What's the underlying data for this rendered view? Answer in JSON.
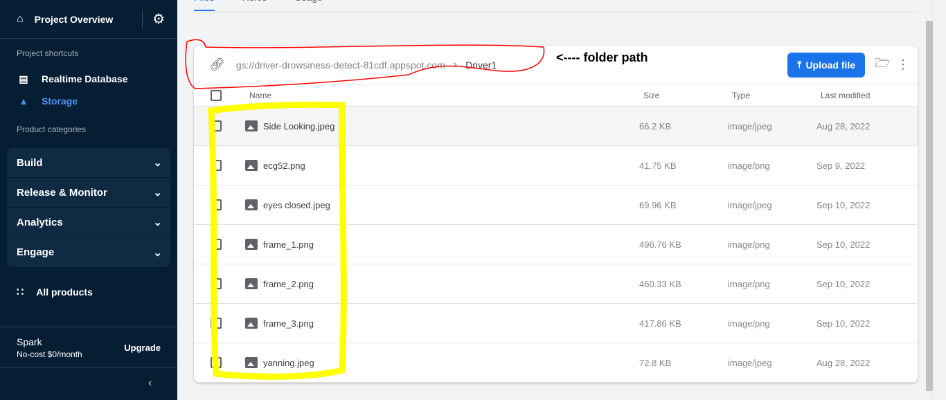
{
  "sidebar": {
    "project_overview": "Project Overview",
    "shortcuts_label": "Project shortcuts",
    "shortcuts": [
      {
        "label": "Realtime Database",
        "icon": "database-icon"
      },
      {
        "label": "Storage",
        "icon": "storage-folder-icon",
        "active": true
      }
    ],
    "categories_label": "Product categories",
    "groups": [
      {
        "label": "Build"
      },
      {
        "label": "Release & Monitor"
      },
      {
        "label": "Analytics"
      },
      {
        "label": "Engage"
      }
    ],
    "all_products": "All products",
    "plan_name": "Spark",
    "plan_desc": "No-cost $0/month",
    "upgrade": "Upgrade"
  },
  "tabs": [
    {
      "label": "Files",
      "active": true
    },
    {
      "label": "Rules"
    },
    {
      "label": "Usage"
    }
  ],
  "storage": {
    "bucket": "gs://driver-drowsiness-detect-81cdf.appspot.com",
    "folder": "Driver1",
    "upload_label": "Upload file",
    "columns": {
      "name": "Name",
      "size": "Size",
      "type": "Type",
      "modified": "Last modified"
    },
    "files": [
      {
        "name": "Side Looking.jpeg",
        "size": "66.2 KB",
        "type": "image/jpeg",
        "modified": "Aug 28, 2022"
      },
      {
        "name": "ecg52.png",
        "size": "41.75 KB",
        "type": "image/png",
        "modified": "Sep 9, 2022"
      },
      {
        "name": "eyes closed.jpeg",
        "size": "69.96 KB",
        "type": "image/jpeg",
        "modified": "Sep 10, 2022"
      },
      {
        "name": "frame_1.png",
        "size": "496.76 KB",
        "type": "image/png",
        "modified": "Sep 10, 2022"
      },
      {
        "name": "frame_2.png",
        "size": "460.33 KB",
        "type": "image/png",
        "modified": "Sep 10, 2022"
      },
      {
        "name": "frame_3.png",
        "size": "417.86 KB",
        "type": "image/png",
        "modified": "Sep 10, 2022"
      },
      {
        "name": "yanning.jpeg",
        "size": "72.8 KB",
        "type": "image/jpeg",
        "modified": "Aug 28, 2022"
      }
    ]
  },
  "annotation": {
    "note": "<---- folder path",
    "outline_colors": [
      "#ff0000",
      "#ffff00"
    ]
  },
  "colors": {
    "sidebar": "#051e34",
    "accent": "#1a73e8",
    "storage_active": "#4a90f0"
  }
}
